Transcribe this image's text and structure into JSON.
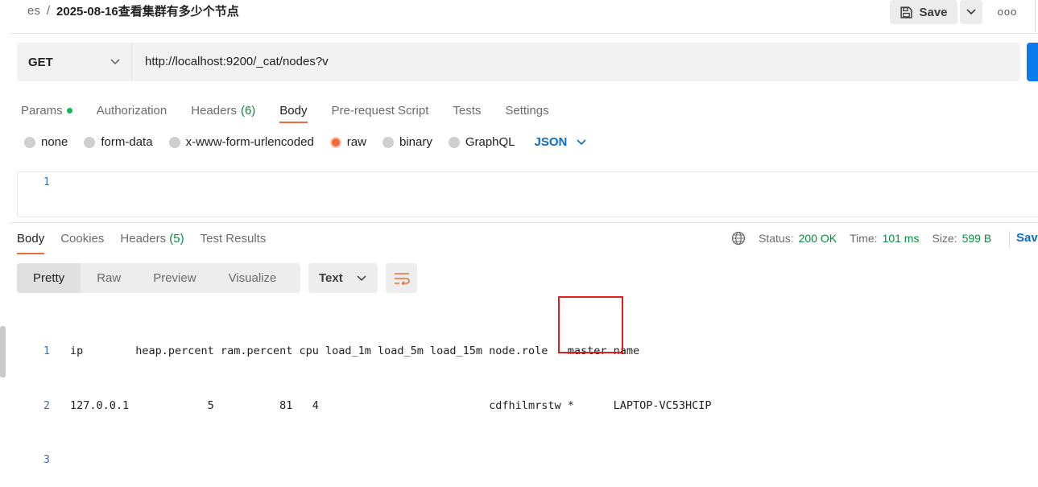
{
  "header": {
    "collection": "es",
    "separator": "/",
    "title": "2025-08-16查看集群有多少个节点",
    "save_label": "Save",
    "more_label": "ooo"
  },
  "request": {
    "method": "GET",
    "url": "http://localhost:9200/_cat/nodes?v",
    "tabs": [
      {
        "label": "Params",
        "dot": true
      },
      {
        "label": "Authorization"
      },
      {
        "label": "Headers",
        "count": "(6)"
      },
      {
        "label": "Body",
        "active": true
      },
      {
        "label": "Pre-request Script"
      },
      {
        "label": "Tests"
      },
      {
        "label": "Settings"
      }
    ],
    "body_types": [
      "none",
      "form-data",
      "x-www-form-urlencoded",
      "raw",
      "binary",
      "GraphQL"
    ],
    "body_type_selected": "raw",
    "format": "JSON",
    "editor_line": "1"
  },
  "response": {
    "tabs": {
      "body": "Body",
      "cookies": "Cookies",
      "headers": "Headers",
      "headers_count": "(5)",
      "test_results": "Test Results"
    },
    "status_label": "Status:",
    "status_value": "200 OK",
    "time_label": "Time:",
    "time_value": "101 ms",
    "size_label": "Size:",
    "size_value": "599 B",
    "save_label": "Sav",
    "views": [
      "Pretty",
      "Raw",
      "Preview",
      "Visualize"
    ],
    "view_selected": "Pretty",
    "text_format": "Text",
    "lines": [
      {
        "n": "1",
        "text": "ip        heap.percent ram.percent cpu load_1m load_5m load_15m node.role   master name"
      },
      {
        "n": "2",
        "text": "127.0.0.1            5          81   4                          cdfhilmrstw *      LAPTOP-VC53HCIP"
      },
      {
        "n": "3",
        "text": ""
      }
    ]
  },
  "colors": {
    "accent": "#f26b3a",
    "link": "#0b6bcb",
    "status_ok": "#0a8a3f",
    "highlight": "#e01e1e"
  }
}
